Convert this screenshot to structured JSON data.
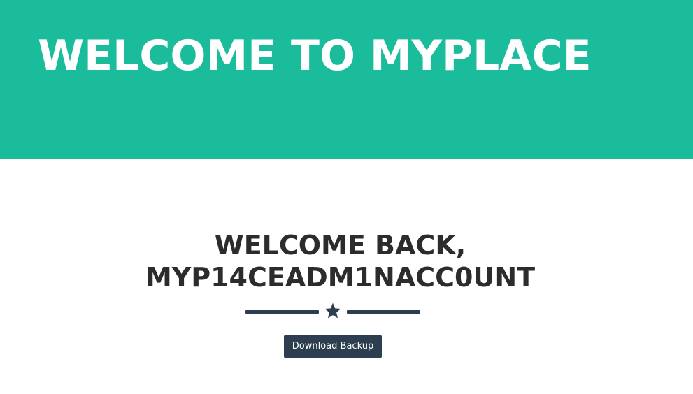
{
  "header": {
    "title": "WELCOME TO MYPLACE"
  },
  "main": {
    "welcome_line1": "WELCOME BACK,",
    "welcome_line2": "MYP14CEADM1NACC0UNT",
    "divider_icon": "star-icon",
    "download_button_label": "Download Backup"
  },
  "colors": {
    "header_bg": "#1abc9c",
    "accent_dark": "#2c3e50",
    "heading_text": "#2c2c2c",
    "header_text": "#ffffff"
  }
}
